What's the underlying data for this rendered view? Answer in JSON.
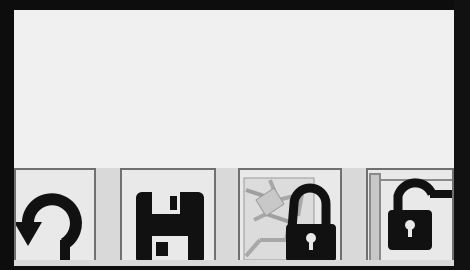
{
  "toolbar": {
    "buttons": [
      {
        "icon": "undo-icon"
      },
      {
        "icon": "save-icon"
      },
      {
        "icon": "map-lock-icon"
      },
      {
        "icon": "page-lock-icon"
      }
    ]
  },
  "colors": {
    "background": "#f0f0f0",
    "toolbar": "#d9d9d9",
    "icon": "#111111",
    "bezel": "#0d0d0d"
  }
}
